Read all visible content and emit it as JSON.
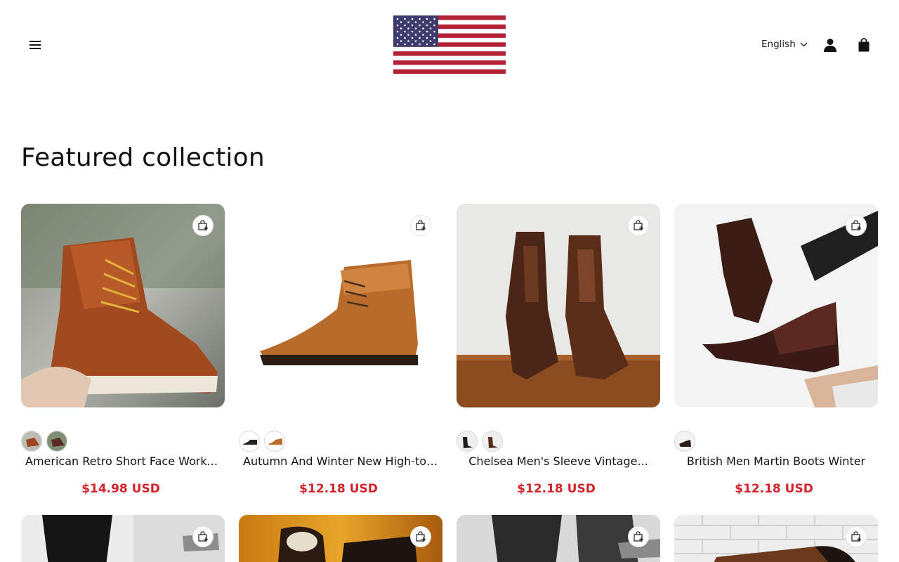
{
  "header": {
    "language": "English",
    "icons": {
      "menu": "hamburger-icon",
      "account": "user-icon",
      "cart": "shopping-bag-icon",
      "language_chevron": "chevron-down-icon"
    },
    "logo": "us-flag-logo"
  },
  "section": {
    "title": "Featured collection"
  },
  "products": [
    {
      "title": "American Retro Short Face Worker...",
      "price": "$14.98 USD"
    },
    {
      "title": "Autumn And Winter New High-top...",
      "price": "$12.18 USD"
    },
    {
      "title": "Chelsea Men's Sleeve Vintage...",
      "price": "$12.18 USD"
    },
    {
      "title": "British Men Martin Boots Winter",
      "price": "$12.18 USD"
    }
  ],
  "colors": {
    "price": "#d4232b",
    "text": "#121212",
    "flag_red": "#b22234",
    "flag_blue": "#3c3b6e"
  }
}
